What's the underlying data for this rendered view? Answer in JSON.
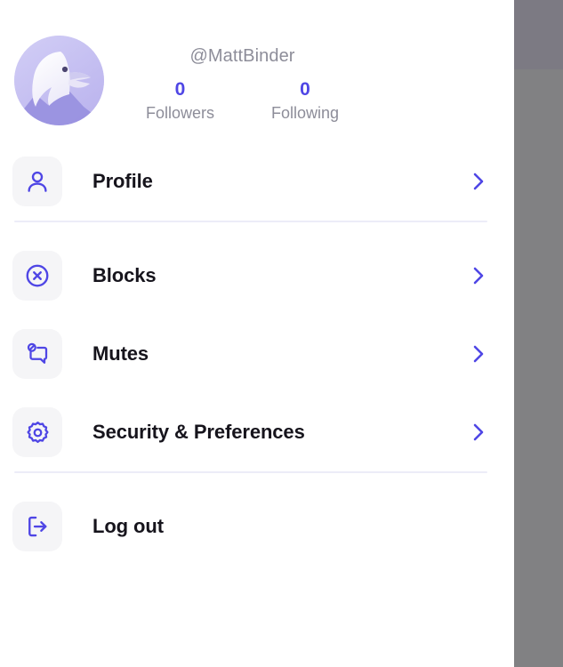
{
  "account": {
    "avatar_icon": "eagle-avatar",
    "handle": "@MattBinder",
    "stats": [
      {
        "count": "0",
        "label": "Followers"
      },
      {
        "count": "0",
        "label": "Following"
      }
    ]
  },
  "menu": {
    "items": [
      {
        "label": "Profile",
        "icon": "person-icon",
        "chevron": "chevron-right-icon"
      },
      {
        "label": "Blocks",
        "icon": "circle-x-icon",
        "chevron": "chevron-right-icon"
      },
      {
        "label": "Mutes",
        "icon": "speech-bubble-mute-icon",
        "chevron": "chevron-right-icon"
      },
      {
        "label": "Security & Preferences",
        "icon": "gear-icon",
        "chevron": "chevron-right-icon"
      }
    ],
    "logout": {
      "label": "Log out",
      "icon": "logout-icon"
    }
  },
  "colors": {
    "accent": "#4f46e5",
    "icon_tile": "#f5f5f7",
    "divider": "#ececf8",
    "label": "#16141c",
    "muted_text": "#8d8d99",
    "backdrop_top": "#7c7a83",
    "backdrop_bottom": "#818183",
    "drawer_bg": "#ffffff"
  }
}
